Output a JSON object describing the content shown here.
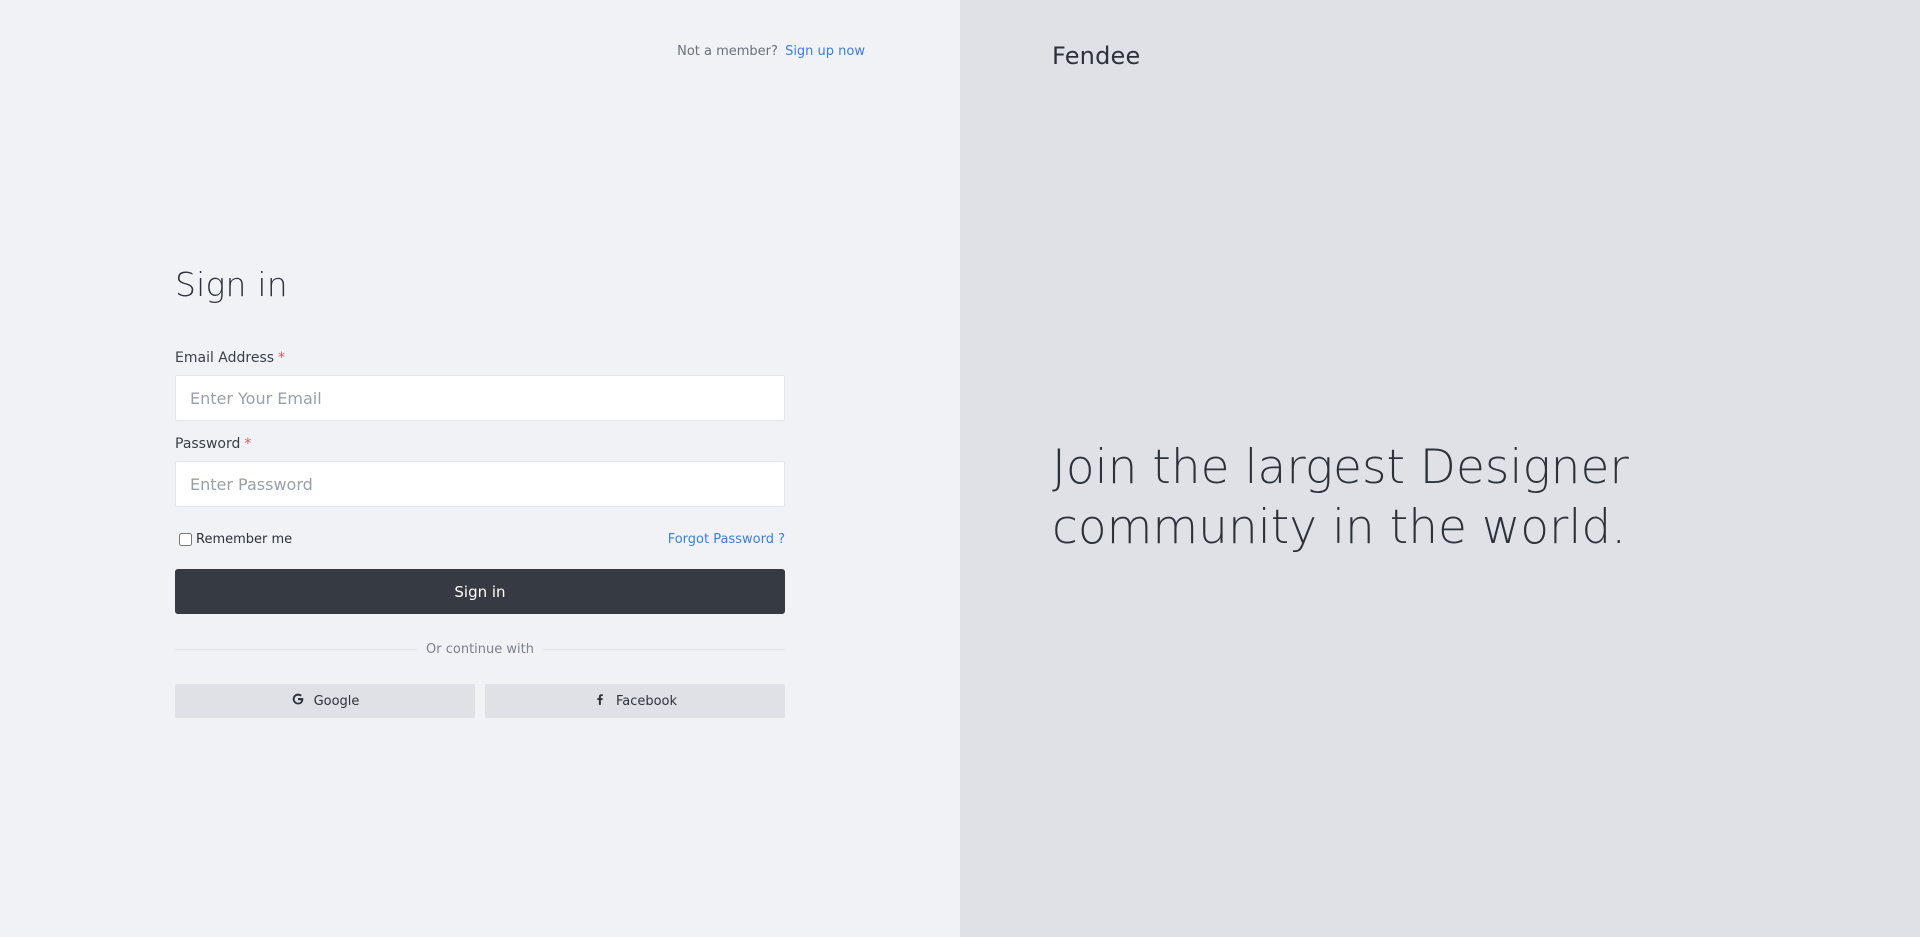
{
  "header": {
    "prompt": "Not a member?",
    "signup_link": "Sign up now"
  },
  "form": {
    "title": "Sign in",
    "email": {
      "label": "Email Address",
      "required_mark": "*",
      "placeholder": "Enter Your Email",
      "value": ""
    },
    "password": {
      "label": "Password",
      "required_mark": "*",
      "placeholder": "Enter Password",
      "value": ""
    },
    "remember_label": "Remember me",
    "remember_checked": false,
    "forgot_link": "Forgot Password ?",
    "submit_label": "Sign in",
    "divider_text": "Or continue with",
    "social": {
      "google_label": "Google",
      "google_icon": "google-icon",
      "facebook_label": "Facebook",
      "facebook_icon": "facebook-icon"
    }
  },
  "aside": {
    "brand": "Fendee",
    "tagline_line1": "Join the largest Designer",
    "tagline_line2": "community in the world."
  },
  "colors": {
    "left_bg": "#f0f2f6",
    "right_bg": "#dfe1e6",
    "link": "#3d7fd9",
    "primary_button": "#353a43",
    "required": "#e25555"
  }
}
